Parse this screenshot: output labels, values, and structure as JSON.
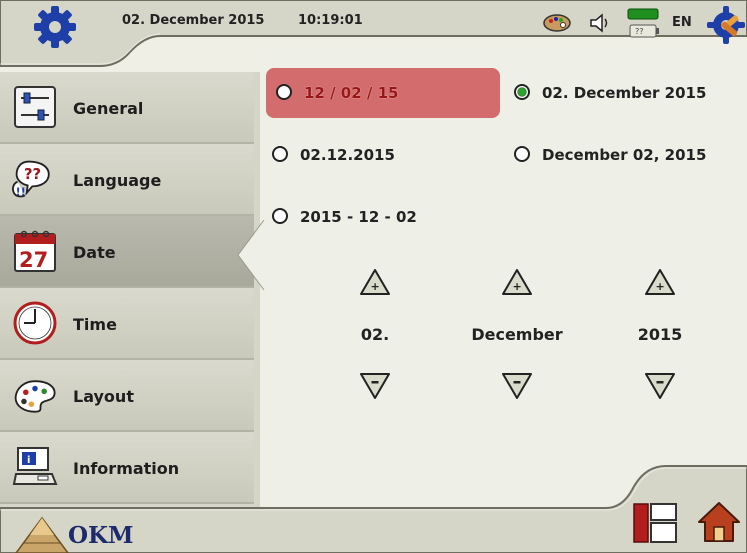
{
  "header": {
    "date": "02. December 2015",
    "time": "10:19:01",
    "language": "EN",
    "battery_label": "??"
  },
  "sidebar": {
    "items": [
      {
        "label": "General"
      },
      {
        "label": "Language"
      },
      {
        "label": "Date"
      },
      {
        "label": "Time"
      },
      {
        "label": "Layout"
      },
      {
        "label": "Information"
      }
    ],
    "active_index": 2
  },
  "date_formats": [
    {
      "label": "12 / 02 / 15",
      "checked": false,
      "highlighted": true
    },
    {
      "label": "02. December  2015",
      "checked": true,
      "highlighted": false
    },
    {
      "label": "02.12.2015",
      "checked": false,
      "highlighted": false
    },
    {
      "label": "December  02,  2015",
      "checked": false,
      "highlighted": false
    },
    {
      "label": "2015 - 12 - 02",
      "checked": false,
      "highlighted": false
    }
  ],
  "date_setter": {
    "day": "02.",
    "month": "December",
    "year": "2015"
  },
  "footer": {
    "logo_text": "OKM"
  },
  "colors": {
    "accent_red": "#d36c6c",
    "radio_green": "#2ea22e",
    "brand_navy": "#1d2a6b"
  }
}
